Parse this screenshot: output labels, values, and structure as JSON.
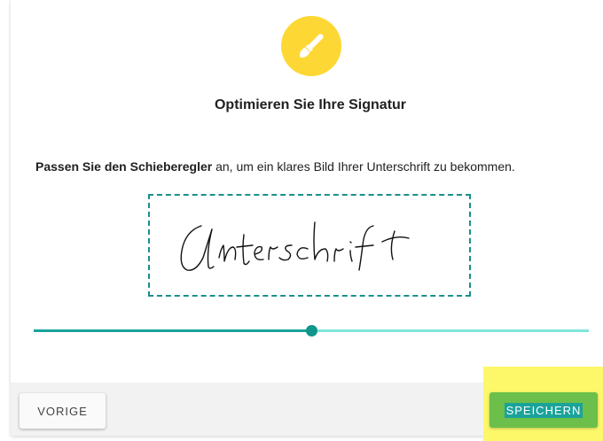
{
  "header": {
    "icon": "brush-icon",
    "title": "Optimieren Sie Ihre Signatur"
  },
  "instruction": {
    "prefix": "Passen Sie den Schieberegler",
    "suffix": " an, um ein klares Bild Ihrer Unterschrift zu bekommen."
  },
  "signature": {
    "text": "Unterschrift"
  },
  "slider": {
    "value_percent": 50
  },
  "footer": {
    "back_label": "VORIGE",
    "save_label": "SPEICHERN"
  },
  "colors": {
    "accent": "#1aa39a",
    "icon_bg": "#fdd835",
    "save_bg": "#6bbf4a",
    "highlight": "#fdf86a"
  }
}
